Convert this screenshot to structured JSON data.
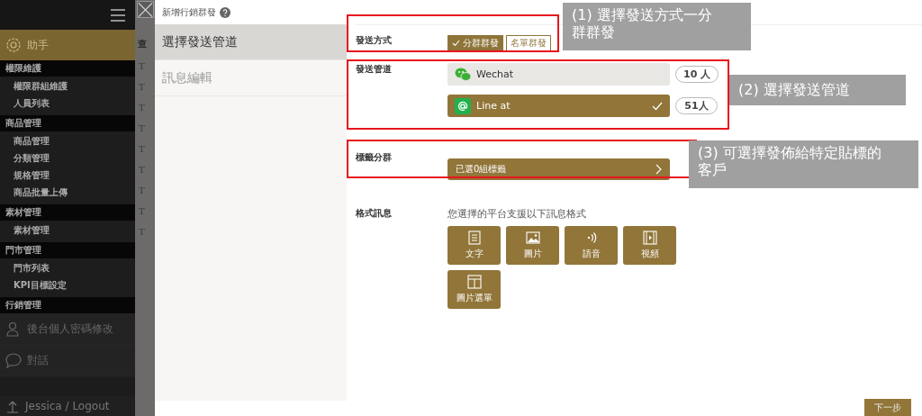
{
  "sidebar": {
    "header_item": {
      "label": "助手",
      "selected": true
    },
    "sections": [
      {
        "title": "權限維護",
        "items": [
          "權限群組維護",
          "人員列表"
        ]
      },
      {
        "title": "商品管理",
        "items": [
          "商品管理",
          "分類管理",
          "規格管理",
          "商品批量上傳"
        ]
      },
      {
        "title": "素材管理",
        "items": [
          "素材管理"
        ]
      },
      {
        "title": "門市管理",
        "items": [
          "門市列表",
          "KPI目標設定"
        ]
      },
      {
        "title": "行銷管理"
      }
    ],
    "bottom_items": [
      {
        "kind": "users",
        "label": "後台個人密碼修改"
      },
      {
        "kind": "chat",
        "label": "對話"
      }
    ],
    "logout": "Jessica / Logout"
  },
  "background_page": {
    "heading": "查",
    "cells": [
      "T",
      "T",
      "T",
      "T",
      "T",
      "T",
      "T",
      "T",
      "T"
    ]
  },
  "dialog": {
    "title": "新增行銷群發",
    "steps": [
      {
        "label": "選擇發送管道",
        "selected": true
      },
      {
        "label": "訊息編輯",
        "selected": false
      }
    ],
    "send_method": {
      "label": "發送方式",
      "options": [
        {
          "label": "分群群發",
          "selected": true
        },
        {
          "label": "名單群發",
          "selected": false
        }
      ]
    },
    "channels": {
      "label": "發送管道",
      "items": [
        {
          "kind": "wechat",
          "name": "Wechat",
          "selected": false,
          "count": "10 人"
        },
        {
          "kind": "line",
          "name": "Line at",
          "selected": true,
          "count": "51人"
        }
      ]
    },
    "tag_group": {
      "label": "標籤分群",
      "button": "已選0組標籤"
    },
    "formats": {
      "label": "格式訊息",
      "hint": "您選擇的平台支援以下訊息格式",
      "items": [
        {
          "kind": "text",
          "label": "文字"
        },
        {
          "kind": "image",
          "label": "圖片"
        },
        {
          "kind": "audio",
          "label": "語音"
        },
        {
          "kind": "video",
          "label": "視頻"
        },
        {
          "kind": "menu",
          "label": "圖片選單"
        }
      ]
    },
    "next_button": "下一步"
  },
  "annotations": [
    {
      "text": "(1) 選擇發送方式一分群群發"
    },
    {
      "text": "(2) 選擇發送管道"
    },
    {
      "text": "(3) 可選擇發佈給特定貼標的客戶"
    }
  ]
}
